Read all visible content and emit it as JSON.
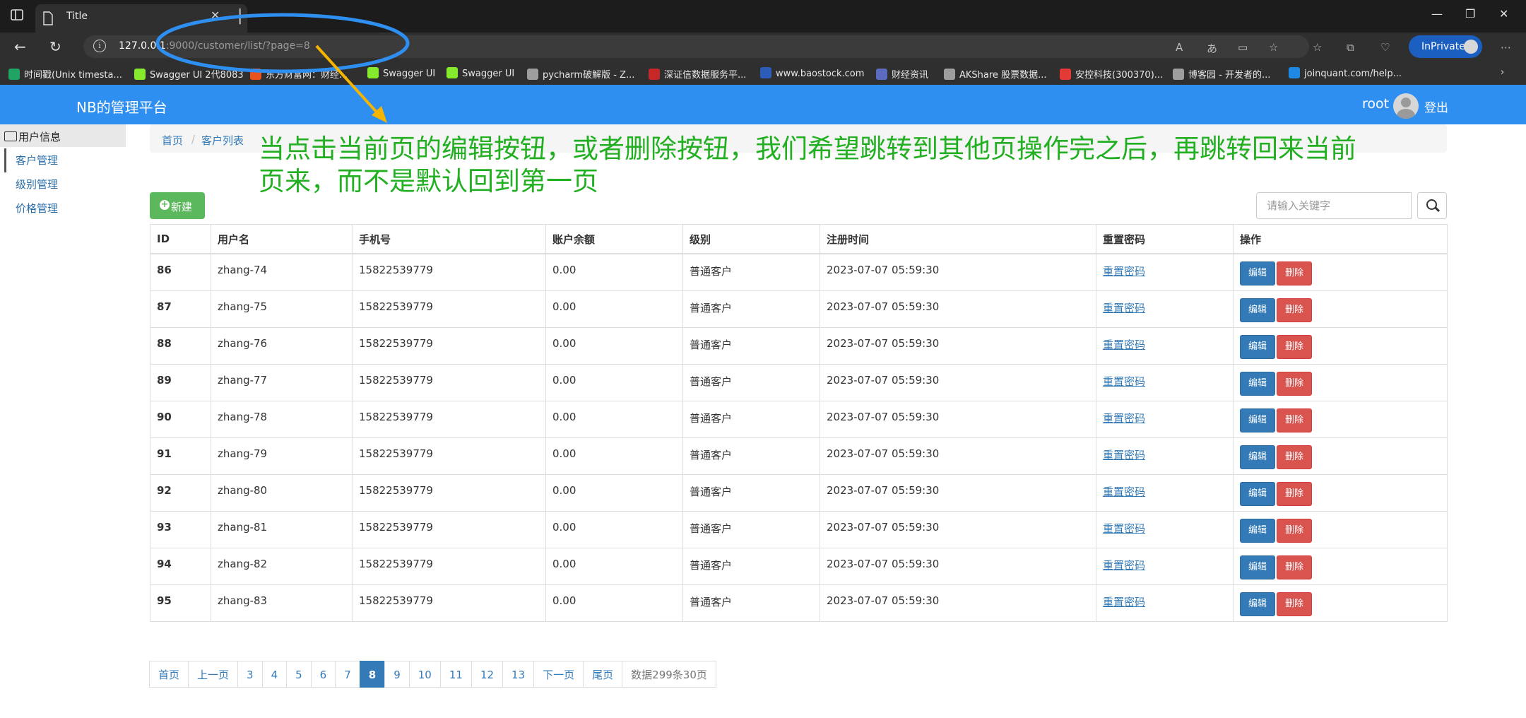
{
  "browser": {
    "tab_title": "Title",
    "url_host": "127.0.0.1",
    "url_path": ":9000/customer/list/?page=8",
    "inprivate_label": "InPrivate",
    "bookmarks": [
      {
        "label": "时间戳(Unix timesta...",
        "color": "#1fa463"
      },
      {
        "label": "Swagger UI 2代8083",
        "color": "#85ea2d"
      },
      {
        "label": "东方财富网：财经...",
        "color": "#e8531f"
      },
      {
        "label": "Swagger UI",
        "color": "#85ea2d"
      },
      {
        "label": "Swagger UI",
        "color": "#85ea2d"
      },
      {
        "label": "pycharm破解版 - Z...",
        "color": "#9e9e9e"
      },
      {
        "label": "深证信数据服务平...",
        "color": "#c62828"
      },
      {
        "label": "www.baostock.com",
        "color": "#2b5db8"
      },
      {
        "label": "财经资讯",
        "color": "#5c6bc0"
      },
      {
        "label": "AKShare 股票数据...",
        "color": "#9e9e9e"
      },
      {
        "label": "安控科技(300370)...",
        "color": "#e53935"
      },
      {
        "label": "博客园 - 开发者的...",
        "color": "#9e9e9e"
      },
      {
        "label": "joinquant.com/help...",
        "color": "#1e88e5"
      }
    ]
  },
  "app": {
    "brand": "NB的管理平台",
    "username": "root",
    "logout": "登出"
  },
  "sidebar": {
    "header": "用户信息",
    "items": [
      {
        "label": "客户管理"
      },
      {
        "label": "级别管理"
      },
      {
        "label": "价格管理"
      }
    ]
  },
  "breadcrumb": {
    "home": "首页",
    "current": "客户列表"
  },
  "annotation": {
    "text": "当点击当前页的编辑按钮，或者删除按钮，我们希望跳转到其他页操作完之后，再跳转回来当前页来，而不是默认回到第一页",
    "color": "#22b022"
  },
  "toolbar": {
    "new_label": "新建",
    "search_placeholder": "请输入关键字"
  },
  "table": {
    "headers": [
      "ID",
      "用户名",
      "手机号",
      "账户余额",
      "级别",
      "注册时间",
      "重置密码",
      "操作"
    ],
    "rows": [
      {
        "id": "86",
        "name": "zhang-74",
        "phone": "15822539779",
        "balance": "0.00",
        "level": "普通客户",
        "created": "2023-07-07 05:59:30",
        "reset": "重置密码",
        "edit": "编辑",
        "del": "删除"
      },
      {
        "id": "87",
        "name": "zhang-75",
        "phone": "15822539779",
        "balance": "0.00",
        "level": "普通客户",
        "created": "2023-07-07 05:59:30",
        "reset": "重置密码",
        "edit": "编辑",
        "del": "删除"
      },
      {
        "id": "88",
        "name": "zhang-76",
        "phone": "15822539779",
        "balance": "0.00",
        "level": "普通客户",
        "created": "2023-07-07 05:59:30",
        "reset": "重置密码",
        "edit": "编辑",
        "del": "删除"
      },
      {
        "id": "89",
        "name": "zhang-77",
        "phone": "15822539779",
        "balance": "0.00",
        "level": "普通客户",
        "created": "2023-07-07 05:59:30",
        "reset": "重置密码",
        "edit": "编辑",
        "del": "删除"
      },
      {
        "id": "90",
        "name": "zhang-78",
        "phone": "15822539779",
        "balance": "0.00",
        "level": "普通客户",
        "created": "2023-07-07 05:59:30",
        "reset": "重置密码",
        "edit": "编辑",
        "del": "删除"
      },
      {
        "id": "91",
        "name": "zhang-79",
        "phone": "15822539779",
        "balance": "0.00",
        "level": "普通客户",
        "created": "2023-07-07 05:59:30",
        "reset": "重置密码",
        "edit": "编辑",
        "del": "删除"
      },
      {
        "id": "92",
        "name": "zhang-80",
        "phone": "15822539779",
        "balance": "0.00",
        "level": "普通客户",
        "created": "2023-07-07 05:59:30",
        "reset": "重置密码",
        "edit": "编辑",
        "del": "删除"
      },
      {
        "id": "93",
        "name": "zhang-81",
        "phone": "15822539779",
        "balance": "0.00",
        "level": "普通客户",
        "created": "2023-07-07 05:59:30",
        "reset": "重置密码",
        "edit": "编辑",
        "del": "删除"
      },
      {
        "id": "94",
        "name": "zhang-82",
        "phone": "15822539779",
        "balance": "0.00",
        "level": "普通客户",
        "created": "2023-07-07 05:59:30",
        "reset": "重置密码",
        "edit": "编辑",
        "del": "删除"
      },
      {
        "id": "95",
        "name": "zhang-83",
        "phone": "15822539779",
        "balance": "0.00",
        "level": "普通客户",
        "created": "2023-07-07 05:59:30",
        "reset": "重置密码",
        "edit": "编辑",
        "del": "删除"
      }
    ]
  },
  "pagination": {
    "items": [
      {
        "label": "首页",
        "active": false
      },
      {
        "label": "上一页",
        "active": false
      },
      {
        "label": "3",
        "active": false
      },
      {
        "label": "4",
        "active": false
      },
      {
        "label": "5",
        "active": false
      },
      {
        "label": "6",
        "active": false
      },
      {
        "label": "7",
        "active": false
      },
      {
        "label": "8",
        "active": true
      },
      {
        "label": "9",
        "active": false
      },
      {
        "label": "10",
        "active": false
      },
      {
        "label": "11",
        "active": false
      },
      {
        "label": "12",
        "active": false
      },
      {
        "label": "13",
        "active": false
      },
      {
        "label": "下一页",
        "active": false
      },
      {
        "label": "尾页",
        "active": false
      }
    ],
    "summary": "数据299条30页"
  },
  "colors": {
    "appbar": "#2e8ff0",
    "annotation_ellipse": "#2e8ff0",
    "arrow": "#f5b400"
  }
}
